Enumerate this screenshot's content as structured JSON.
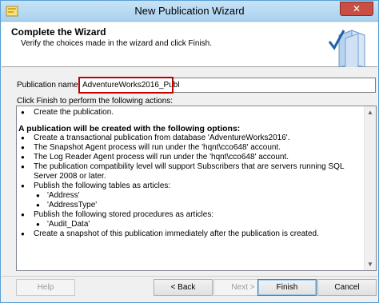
{
  "window": {
    "title": "New Publication Wizard",
    "close_label": "✕"
  },
  "header": {
    "title": "Complete the Wizard",
    "subtitle": "Verify the choices made in the wizard and click Finish."
  },
  "form": {
    "publication_name_label": "Publication name:",
    "publication_name_value": "AdventureWorks2016_Publ",
    "instructions": "Click Finish to perform the following actions:"
  },
  "actions": {
    "create": "Create the publication.",
    "options_heading": "A publication will be created with the following options:",
    "items": [
      "Create a transactional publication from database 'AdventureWorks2016'.",
      "The Snapshot Agent process will run under the 'hqnt\\cco648' account.",
      "The Log Reader Agent process will run under the 'hqnt\\cco648' account.",
      "The publication compatibility level will support Subscribers that are servers running SQL Server 2008 or later.",
      "Publish the following tables as articles:"
    ],
    "tables": [
      "'Address'",
      "'AddressType'"
    ],
    "procs_heading": "Publish the following stored procedures as articles:",
    "procs": [
      "'Audit_Data'"
    ],
    "snapshot": "Create a snapshot of this publication immediately after the publication is created."
  },
  "buttons": {
    "help": "Help",
    "back": "< Back",
    "next": "Next >",
    "finish": "Finish",
    "cancel": "Cancel"
  }
}
